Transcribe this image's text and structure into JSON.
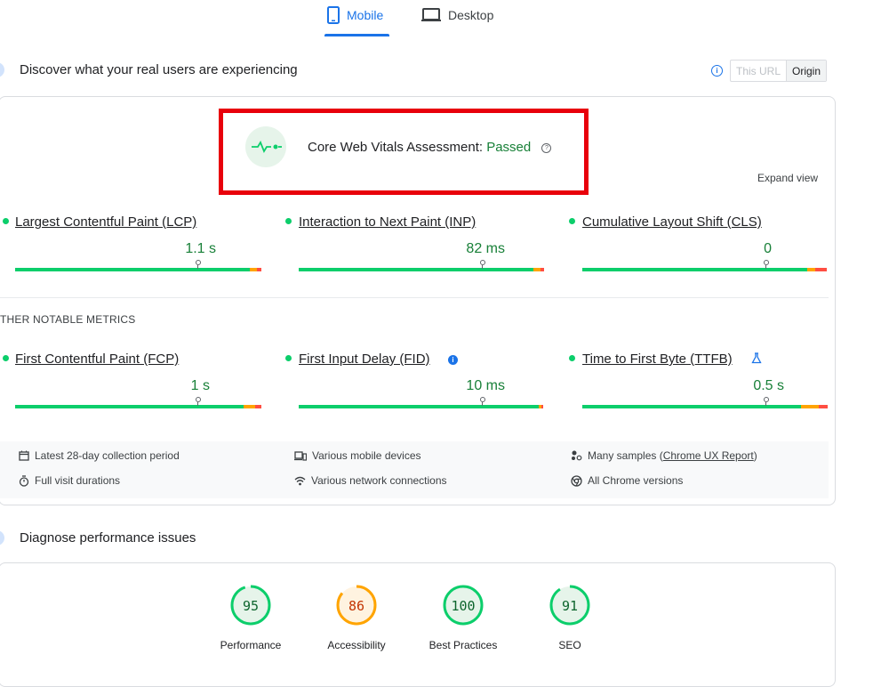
{
  "tabs": {
    "mobile": "Mobile",
    "desktop": "Desktop"
  },
  "field": {
    "title": "Discover what your real users are experiencing",
    "toggle": {
      "this_url": "This URL",
      "origin": "Origin"
    },
    "assessment_label": "Core Web Vitals Assessment:",
    "assessment_status": "Passed",
    "expand": "Expand view"
  },
  "core_metrics": [
    {
      "name": "Largest Contentful Paint (LCP)",
      "value": "1.1 s"
    },
    {
      "name": "Interaction to Next Paint (INP)",
      "value": "82 ms"
    },
    {
      "name": "Cumulative Layout Shift (CLS)",
      "value": "0"
    }
  ],
  "other_title": "THER NOTABLE METRICS",
  "other_metrics": [
    {
      "name": "First Contentful Paint (FCP)",
      "value": "1 s"
    },
    {
      "name": "First Input Delay (FID)",
      "value": "10 ms"
    },
    {
      "name": "Time to First Byte (TTFB)",
      "value": "0.5 s"
    }
  ],
  "footer": {
    "period": "Latest 28-day collection period",
    "durations": "Full visit durations",
    "devices": "Various mobile devices",
    "network": "Various network connections",
    "samples_prefix": "Many samples (",
    "samples_link": "Chrome UX Report",
    "samples_suffix": ")",
    "chrome": "All Chrome versions"
  },
  "diagnose": {
    "title": "Diagnose performance issues"
  },
  "scores": [
    {
      "label": "Performance",
      "value": "95",
      "score": 95,
      "color": "#0cce6b",
      "bg": "#e6f4ea",
      "text": "#0d652d"
    },
    {
      "label": "Accessibility",
      "value": "86",
      "score": 86,
      "color": "#ffa400",
      "bg": "#fff3e0",
      "text": "#c33300"
    },
    {
      "label": "Best Practices",
      "value": "100",
      "score": 100,
      "color": "#0cce6b",
      "bg": "#e6f4ea",
      "text": "#0d652d"
    },
    {
      "label": "SEO",
      "value": "91",
      "score": 91,
      "color": "#0cce6b",
      "bg": "#e6f4ea",
      "text": "#0d652d"
    }
  ],
  "colors": {
    "accent": "#1a73e8",
    "good": "#0cce6b",
    "average": "#ffa400",
    "poor": "#ff4e42",
    "highlight": "#e8000b"
  }
}
